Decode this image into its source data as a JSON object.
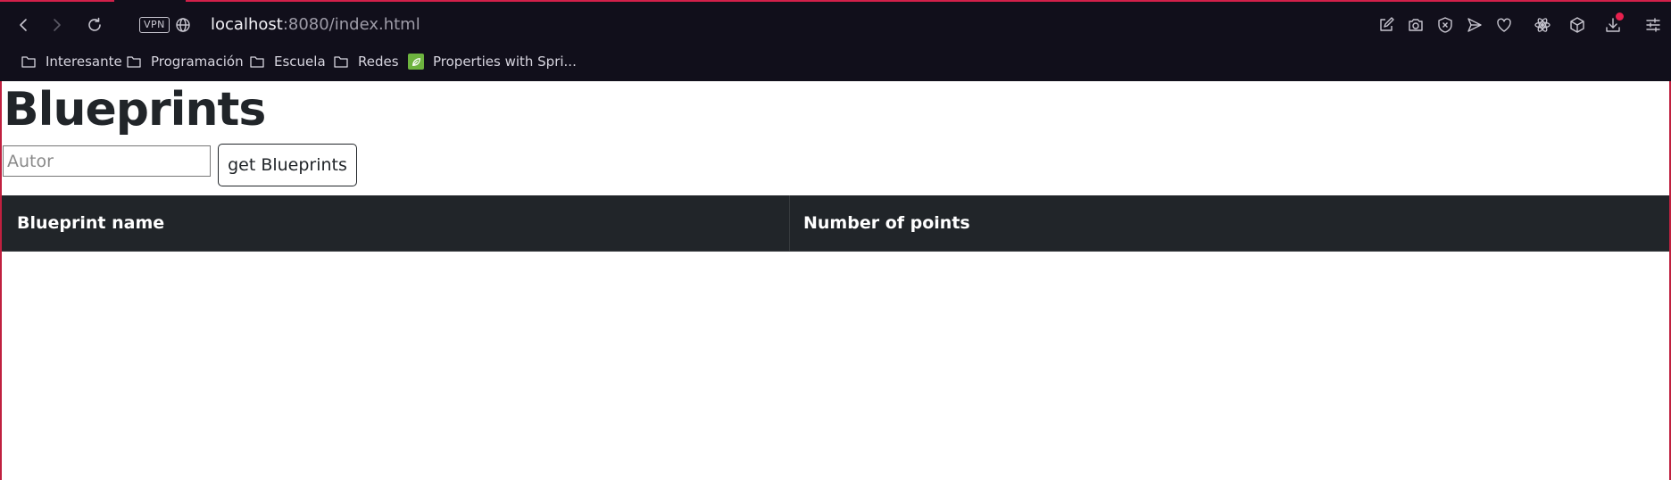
{
  "browser": {
    "vpn_label": "VPN",
    "url": {
      "host": "localhost",
      "rest": ":8080/index.html"
    },
    "toolbar_icons_left": [
      "back-icon",
      "forward-icon",
      "reload-icon",
      "vpn-badge",
      "site-info-icon"
    ],
    "toolbar_icons_right": [
      "snapshot-share-icon",
      "camera-icon",
      "shield-icon",
      "send-icon",
      "heart-icon",
      "react-icon",
      "cube-icon",
      "download-icon",
      "settings-sliders-icon"
    ],
    "bookmarks": [
      {
        "label": "Interesante",
        "icon": "folder-icon"
      },
      {
        "label": "Programación",
        "icon": "folder-icon"
      },
      {
        "label": "Escuela",
        "icon": "folder-icon"
      },
      {
        "label": "Redes",
        "icon": "folder-icon"
      },
      {
        "label": "Properties with Spri...",
        "icon": "spring-leaf-icon"
      }
    ],
    "colors": {
      "chrome_bg": "#110f1b",
      "accent": "#d2204a",
      "notification_dot": "#e8204e"
    }
  },
  "page": {
    "title": "Blueprints",
    "author_input": {
      "placeholder": "Autor",
      "value": ""
    },
    "get_button_label": "get Blueprints",
    "table": {
      "headers": [
        "Blueprint name",
        "Number of points"
      ],
      "rows": []
    },
    "colors": {
      "table_header_bg": "#212529",
      "table_header_text": "#ffffff",
      "title_text": "#212529"
    }
  }
}
